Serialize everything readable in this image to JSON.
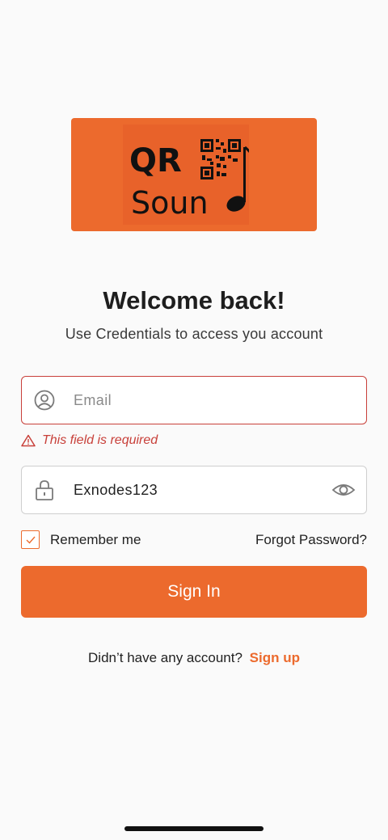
{
  "logo": {
    "text_line1": "QR",
    "text_line2": "Soun",
    "brand_color": "#ec6a2d"
  },
  "header": {
    "title": "Welcome back!",
    "subtitle": "Use Credentials to access you account"
  },
  "form": {
    "email": {
      "placeholder": "Email",
      "value": "",
      "error": "This field is required",
      "icon": "user-circle-icon"
    },
    "password": {
      "value": "Exnodes123",
      "icon": "lock-icon",
      "toggle_icon": "eye-icon"
    },
    "remember_label": "Remember me",
    "remember_checked": true,
    "forgot_label": "Forgot Password?",
    "submit_label": "Sign In"
  },
  "footer": {
    "prompt": "Didn’t have any account?",
    "signup_label": "Sign up"
  },
  "colors": {
    "accent": "#ec6a2d",
    "error": "#c8403a"
  }
}
